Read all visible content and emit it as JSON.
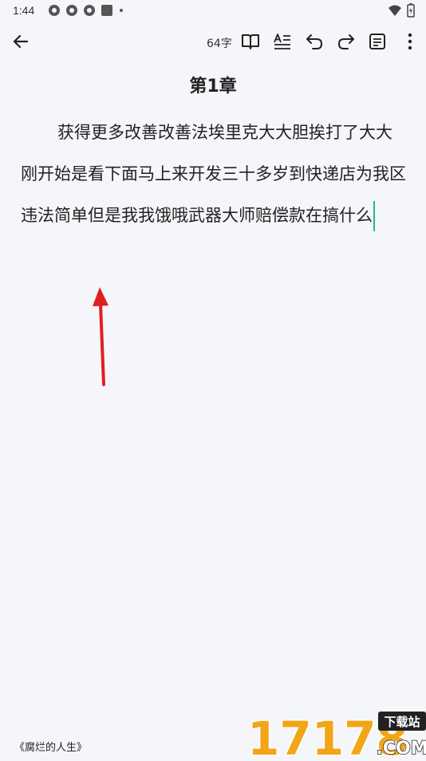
{
  "status_bar": {
    "time": "1:44"
  },
  "toolbar": {
    "word_count": "64字"
  },
  "chapter": {
    "title": "第1章",
    "text": "获得更多改善改善法埃里克大大胆挨打了大大刚开始是看下面马上来开发三十多岁到快递店为我区违法简单但是我我饿哦武器大师赔偿款在搞什么"
  },
  "footer": {
    "book_title": "《腐烂的人生》"
  },
  "watermark": {
    "brand": "17178",
    "tag": "下载站",
    "domain": ".COM"
  },
  "colors": {
    "cursor": "#26b59a",
    "arrow": "#e02020",
    "background": "#f5f6fa"
  }
}
